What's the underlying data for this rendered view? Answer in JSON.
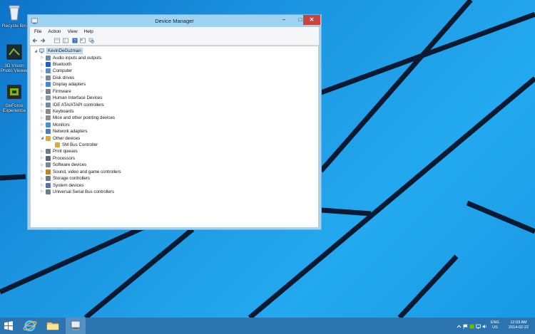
{
  "desktop": {
    "icons": [
      {
        "label": "Recycle Bin",
        "icon": "recycle-bin-icon"
      },
      {
        "label": "3D Vision Photo Viewer",
        "icon": "3d-vision-icon"
      },
      {
        "label": "GeForce Experience",
        "icon": "geforce-icon"
      }
    ]
  },
  "window": {
    "title": "Device Manager",
    "minimize": "–",
    "maximize": "□",
    "close": "✕",
    "menu": [
      "File",
      "Action",
      "View",
      "Help"
    ],
    "tree": {
      "root": "KevinDeGuzman",
      "items": [
        {
          "label": "Audio inputs and outputs",
          "expander": "▷"
        },
        {
          "label": "Bluetooth",
          "expander": "▷"
        },
        {
          "label": "Computer",
          "expander": "▷"
        },
        {
          "label": "Disk drives",
          "expander": "▷"
        },
        {
          "label": "Display adapters",
          "expander": "▷"
        },
        {
          "label": "Firmware",
          "expander": "▷"
        },
        {
          "label": "Human Interface Devices",
          "expander": "▷"
        },
        {
          "label": "IDE ATA/ATAPI controllers",
          "expander": "▷"
        },
        {
          "label": "Keyboards",
          "expander": "▷"
        },
        {
          "label": "Mice and other pointing devices",
          "expander": "▷"
        },
        {
          "label": "Monitors",
          "expander": "▷"
        },
        {
          "label": "Network adapters",
          "expander": "▷"
        },
        {
          "label": "Other devices",
          "expander": "◢"
        },
        {
          "label": "SM Bus Controller",
          "expander": ""
        },
        {
          "label": "Print queues",
          "expander": "▷"
        },
        {
          "label": "Processors",
          "expander": "▷"
        },
        {
          "label": "Software devices",
          "expander": "▷"
        },
        {
          "label": "Sound, video and game controllers",
          "expander": "▷"
        },
        {
          "label": "Storage controllers",
          "expander": "▷"
        },
        {
          "label": "System devices",
          "expander": "▷"
        },
        {
          "label": "Universal Serial Bus controllers",
          "expander": "▷"
        }
      ]
    }
  },
  "taskbar": {
    "lang_line1": "ENG",
    "lang_line2": "US",
    "time": "12:03 AM",
    "date": "2014-02-22"
  },
  "colors": {
    "accent": "#2b74b0",
    "window_frame": "#9fd3f4",
    "close": "#c7443f",
    "desktop": "#1a8fd8"
  }
}
